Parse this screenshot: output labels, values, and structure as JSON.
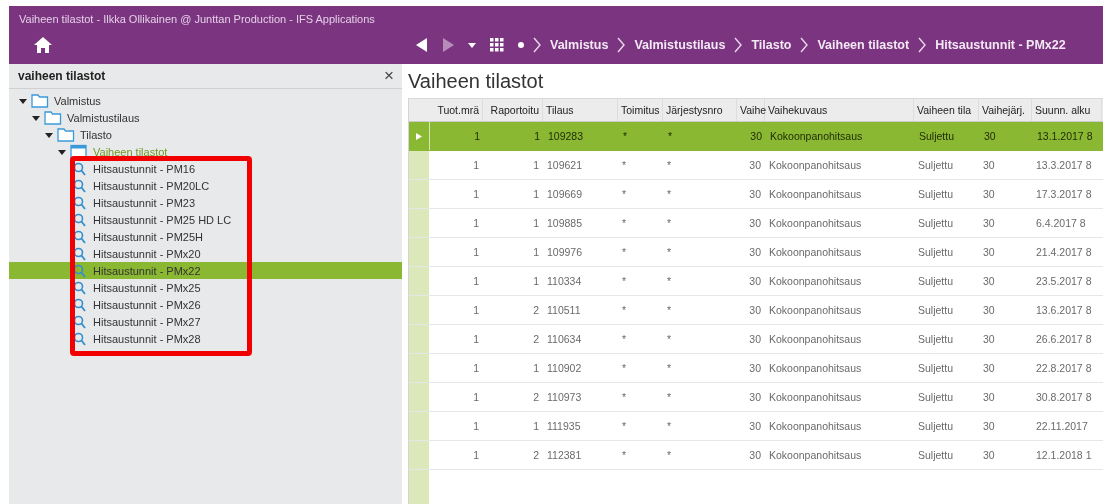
{
  "window": {
    "title": "Vaiheen tilastot - Ilkka Ollikainen @ Junttan Production - IFS Applications"
  },
  "navigation": {
    "breadcrumbs": [
      "Valmistus",
      "Valmistustilaus",
      "Tilasto",
      "Vaiheen tilastot",
      "Hitsaustunnit - PMx22"
    ]
  },
  "navigator_panel": {
    "title": "vaiheen tilastot",
    "close": "×",
    "tree": [
      {
        "label": "Valmistus",
        "kind": "folder",
        "expanded": true,
        "active": false,
        "children": [
          {
            "label": "Valmistustilaus",
            "kind": "folder",
            "expanded": true,
            "active": false,
            "children": [
              {
                "label": "Tilasto",
                "kind": "folder",
                "expanded": true,
                "active": false,
                "children": [
                  {
                    "label": "Vaiheen tilastot",
                    "kind": "window",
                    "expanded": true,
                    "active": true,
                    "children": [
                      {
                        "label": "Hitsaustunnit - PM16",
                        "kind": "query",
                        "selected": false
                      },
                      {
                        "label": "Hitsaustunnit - PM20LC",
                        "kind": "query",
                        "selected": false
                      },
                      {
                        "label": "Hitsaustunnit - PM23",
                        "kind": "query",
                        "selected": false
                      },
                      {
                        "label": "Hitsaustunnit - PM25 HD LC",
                        "kind": "query",
                        "selected": false
                      },
                      {
                        "label": "Hitsaustunnit - PM25H",
                        "kind": "query",
                        "selected": false
                      },
                      {
                        "label": "Hitsaustunnit - PMx20",
                        "kind": "query",
                        "selected": false
                      },
                      {
                        "label": "Hitsaustunnit - PMx22",
                        "kind": "query",
                        "selected": true
                      },
                      {
                        "label": "Hitsaustunnit - PMx25",
                        "kind": "query",
                        "selected": false
                      },
                      {
                        "label": "Hitsaustunnit - PMx26",
                        "kind": "query",
                        "selected": false
                      },
                      {
                        "label": "Hitsaustunnit - PMx27",
                        "kind": "query",
                        "selected": false
                      },
                      {
                        "label": "Hitsaustunnit - PMx28",
                        "kind": "query",
                        "selected": false
                      }
                    ]
                  }
                ]
              }
            ]
          }
        ]
      }
    ]
  },
  "content": {
    "title": "Vaiheen tilastot",
    "table": {
      "columns": [
        "Tuot.mrä",
        "Raportoitu",
        "Tilaus",
        "Toimitus",
        "Järjestysnro",
        "Vaihe",
        "Vaihekuvaus",
        "Vaiheen tila",
        "Vaihejärj.",
        "Suunn. alku"
      ],
      "rows": [
        {
          "selected": true,
          "cells": [
            "1",
            "1",
            "109283",
            "*",
            "*",
            "30",
            "Kokoonpanohitsaus",
            "Suljettu",
            "30",
            "13.1.2017 8"
          ]
        },
        {
          "selected": false,
          "cells": [
            "1",
            "1",
            "109621",
            "*",
            "*",
            "30",
            "Kokoonpanohitsaus",
            "Suljettu",
            "30",
            "13.3.2017 8"
          ]
        },
        {
          "selected": false,
          "cells": [
            "1",
            "1",
            "109669",
            "*",
            "*",
            "30",
            "Kokoonpanohitsaus",
            "Suljettu",
            "30",
            "17.3.2017 8"
          ]
        },
        {
          "selected": false,
          "cells": [
            "1",
            "1",
            "109885",
            "*",
            "*",
            "30",
            "Kokoonpanohitsaus",
            "Suljettu",
            "30",
            "6.4.2017 8"
          ]
        },
        {
          "selected": false,
          "cells": [
            "1",
            "1",
            "109976",
            "*",
            "*",
            "30",
            "Kokoonpanohitsaus",
            "Suljettu",
            "30",
            "21.4.2017 8"
          ]
        },
        {
          "selected": false,
          "cells": [
            "1",
            "1",
            "110334",
            "*",
            "*",
            "30",
            "Kokoonpanohitsaus",
            "Suljettu",
            "30",
            "23.5.2017 8"
          ]
        },
        {
          "selected": false,
          "cells": [
            "1",
            "2",
            "110511",
            "*",
            "*",
            "30",
            "Kokoonpanohitsaus",
            "Suljettu",
            "30",
            "13.6.2017 8"
          ]
        },
        {
          "selected": false,
          "cells": [
            "1",
            "2",
            "110634",
            "*",
            "*",
            "30",
            "Kokoonpanohitsaus",
            "Suljettu",
            "30",
            "26.6.2017 8"
          ]
        },
        {
          "selected": false,
          "cells": [
            "1",
            "1",
            "110902",
            "*",
            "*",
            "30",
            "Kokoonpanohitsaus",
            "Suljettu",
            "30",
            "22.8.2017 8"
          ]
        },
        {
          "selected": false,
          "cells": [
            "1",
            "2",
            "110973",
            "*",
            "*",
            "30",
            "Kokoonpanohitsaus",
            "Suljettu",
            "30",
            "30.8.2017 8"
          ]
        },
        {
          "selected": false,
          "cells": [
            "1",
            "1",
            "111935",
            "*",
            "*",
            "30",
            "Kokoonpanohitsaus",
            "Suljettu",
            "30",
            "22.11.2017"
          ]
        },
        {
          "selected": false,
          "cells": [
            "1",
            "2",
            "112381",
            "*",
            "*",
            "30",
            "Kokoonpanohitsaus",
            "Suljettu",
            "30",
            "12.1.2018 1"
          ]
        }
      ]
    }
  }
}
